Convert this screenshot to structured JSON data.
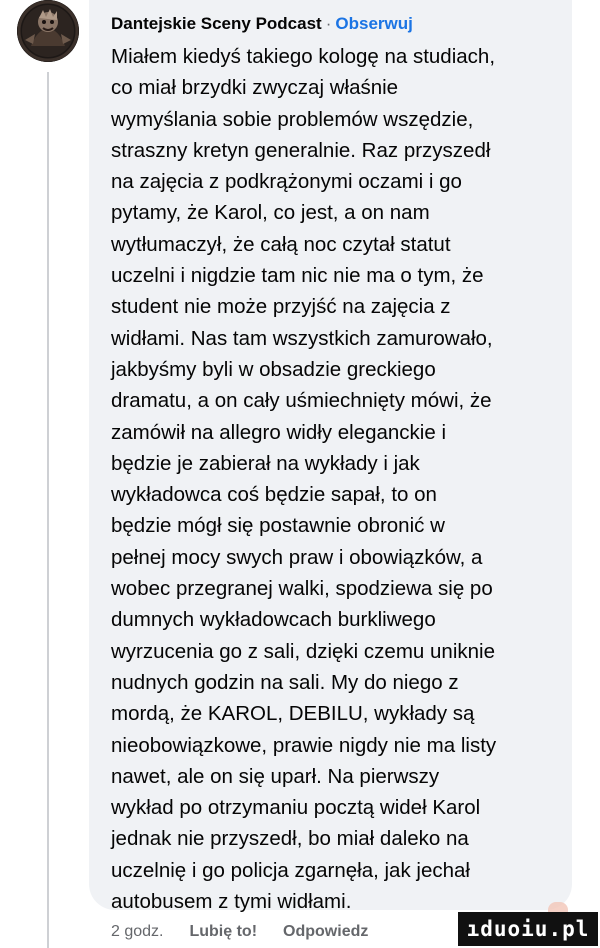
{
  "comment": {
    "author": "Dantejskie Sceny Podcast",
    "separator": "·",
    "follow_label": "Obserwuj",
    "text": "Miałem kiedyś takiego kologę na studiach,\nco miał brzydki zwyczaj właśnie\nwymyślania sobie problemów wszędzie,\nstraszny kretyn generalnie. Raz przyszedł\nna zajęcia z podkrążonymi oczami i go\npytamy, że Karol, co jest, a on nam\nwytłumaczył, że całą noc czytał statut\nuczelni i nigdzie tam nic nie ma o tym, że\nstudent nie może przyjść na zajęcia z\nwidłami. Nas tam wszystkich zamurowało,\njakbyśmy byli w obsadzie greckiego\ndramatu, a on cały uśmiechnięty mówi, że\nzamówił na allegro widły eleganckie i\nbędzie je zabierał na wykłady i jak\nwykładowca coś będzie sapał, to on\nbędzie mógł się postawnie obronić w\npełnej mocy swych praw i obowiązków, a\nwobec przegranej walki, spodziewa się po\ndumnych wykładowcach burkliwego\nwyrzucenia go z sali, dzięki czemu uniknie\nnudnych godzin na sali. My do niego z\nmordą, że KAROL, DEBILU, wykłady są\nnieobowiązkowe, prawie nigdy nie ma listy\nnawet, ale on się uparł. Na pierwszy\nwykład po otrzymaniu pocztą wideł Karol\njednak nie przyszedł, bo miał daleko na\nuczelnię i go policja zgarnęła, jak jechał\nautobusem z tymi widłami."
  },
  "actions": {
    "time": "2 godz.",
    "like_label": "Lubię to!",
    "reply_label": "Odpowiedz"
  },
  "watermark": "ıduoiu.pl",
  "colors": {
    "bubble_bg": "#f0f2f5",
    "link_blue": "#1b74e4",
    "meta_gray": "#65676b",
    "text": "#050505"
  },
  "icons": {
    "avatar": "podcast-avatar-image"
  }
}
